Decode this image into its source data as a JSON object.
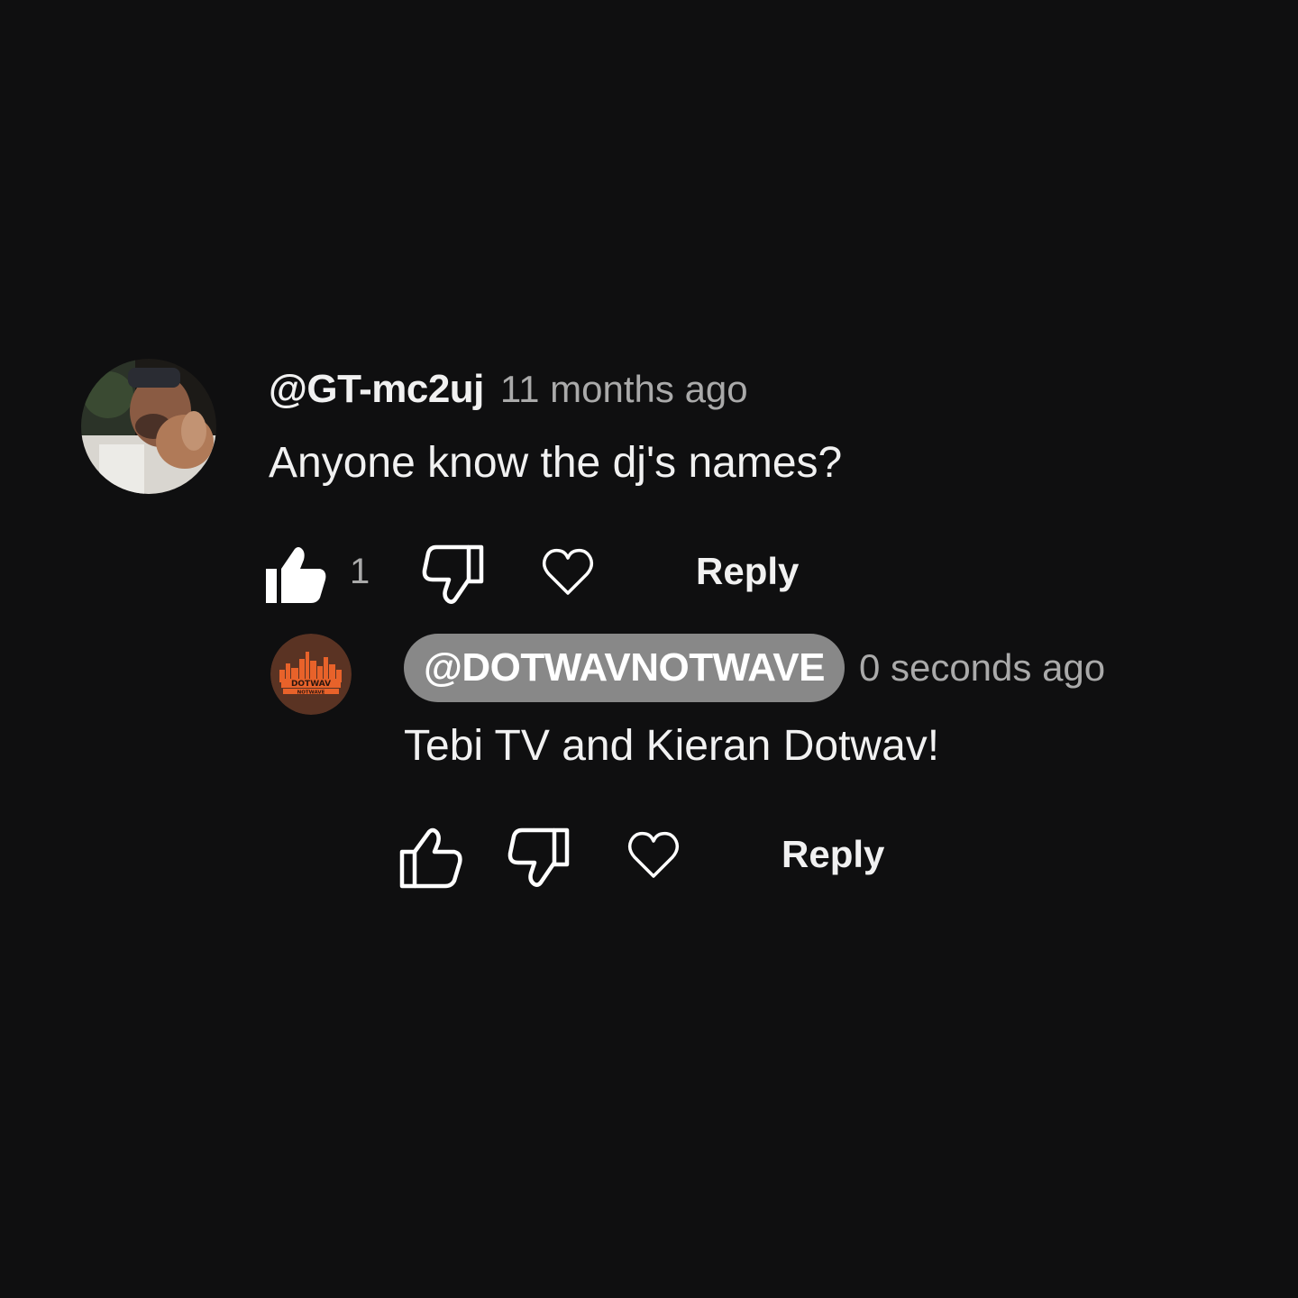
{
  "comments": [
    {
      "author": "@GT-mc2uj",
      "time": "11 months ago",
      "text": "Anyone know the dj's names?",
      "like_count": "1",
      "reply_label": "Reply",
      "avatar": "user-photo-avatar"
    },
    {
      "author": "@DOTWAVNOTWAVE",
      "time": "0 seconds ago",
      "text": "Tebi TV and Kieran Dotwav!",
      "reply_label": "Reply",
      "avatar": "dotwav-logo-avatar",
      "avatar_logo_text": "DOTWAV NOTWAVE"
    }
  ],
  "icons": {
    "like": "thumbs-up-icon",
    "dislike": "thumbs-down-icon",
    "heart": "heart-icon"
  },
  "colors": {
    "background": "#0f0f10",
    "text": "#f1f1f1",
    "muted": "#aaaaaa",
    "highlight_pill": "#888888",
    "logo_orange": "#e8622a",
    "logo_brown": "#5a3323"
  }
}
